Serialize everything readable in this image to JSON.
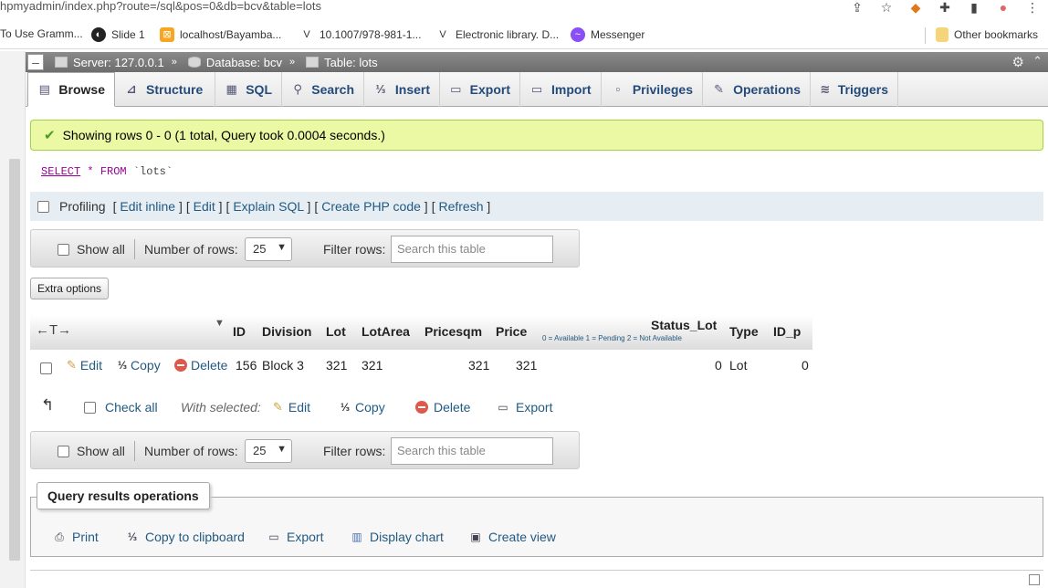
{
  "browser": {
    "url": "hpmyadmin/index.php?route=/sql&pos=0&db=bcv&table=lots",
    "bookmarks": [
      {
        "label": "To Use Gramm..."
      },
      {
        "label": "Slide 1"
      },
      {
        "label": "localhost/Bayamba..."
      },
      {
        "label": "10.1007/978-981-1..."
      },
      {
        "label": "Electronic library. D..."
      },
      {
        "label": "Messenger"
      }
    ],
    "other_bookmarks": "Other bookmarks"
  },
  "breadcrumb": {
    "server": "Server: 127.0.0.1",
    "database": "Database: bcv",
    "table": "Table: lots",
    "separator": "»"
  },
  "tabs": [
    {
      "label": "Browse",
      "icon": "browse-icon",
      "active": true
    },
    {
      "label": "Structure",
      "icon": "structure-icon"
    },
    {
      "label": "SQL",
      "icon": "sql-icon"
    },
    {
      "label": "Search",
      "icon": "search-icon"
    },
    {
      "label": "Insert",
      "icon": "insert-icon"
    },
    {
      "label": "Export",
      "icon": "export-icon"
    },
    {
      "label": "Import",
      "icon": "import-icon"
    },
    {
      "label": "Privileges",
      "icon": "privileges-icon"
    },
    {
      "label": "Operations",
      "icon": "operations-icon"
    },
    {
      "label": "Triggers",
      "icon": "triggers-icon"
    }
  ],
  "message": {
    "success": "Showing rows 0 - 0 (1 total, Query took 0.0004 seconds.)",
    "color": "#ebf8a4"
  },
  "query": {
    "select": "SELECT",
    "star": "*",
    "from": "FROM",
    "table": "`lots`"
  },
  "profiling": {
    "label": "Profiling",
    "links": [
      "Edit inline",
      "Edit",
      "Explain SQL",
      "Create PHP code",
      "Refresh"
    ]
  },
  "nav": {
    "show_all": "Show all",
    "num_rows_label": "Number of rows:",
    "num_rows_value": "25",
    "filter_label": "Filter rows:",
    "filter_placeholder": "Search this table"
  },
  "extra_options": "Extra options",
  "table": {
    "columns": [
      "ID",
      "Division",
      "Lot",
      "LotArea",
      "Pricesqm",
      "Price",
      "Status_Lot",
      "Type",
      "ID_p"
    ],
    "status_comment": "0 = Available 1 = Pending 2 = Not Available",
    "row_actions": {
      "edit": "Edit",
      "copy": "Copy",
      "delete": "Delete"
    },
    "rows": [
      {
        "ID": "156",
        "Division": "Block 3",
        "Lot": "321",
        "LotArea": "321",
        "Pricesqm": "321",
        "Price": "321",
        "Status_Lot": "0",
        "Type": "Lot",
        "ID_p": "0"
      }
    ]
  },
  "with_selected": {
    "check_all": "Check all",
    "label": "With selected:",
    "edit": "Edit",
    "copy": "Copy",
    "delete": "Delete",
    "export": "Export"
  },
  "qro": {
    "title": "Query results operations",
    "print": "Print",
    "copy_clipboard": "Copy to clipboard",
    "export": "Export",
    "display_chart": "Display chart",
    "create_view": "Create view"
  }
}
